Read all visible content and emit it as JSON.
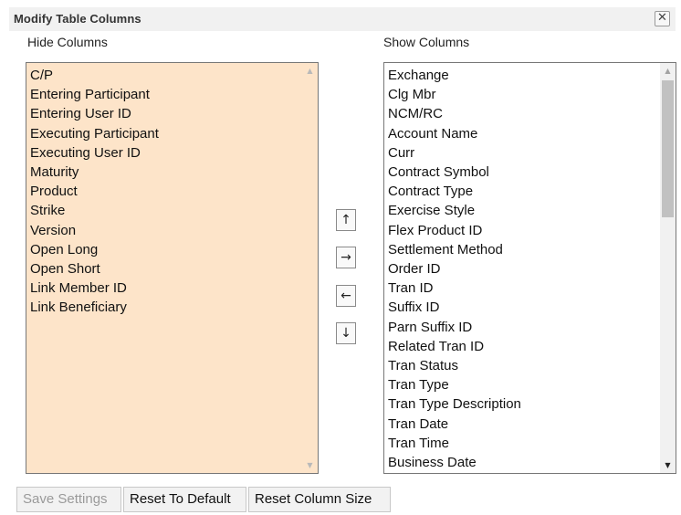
{
  "dialog": {
    "title": "Modify Table Columns",
    "close_symbol": "✕"
  },
  "hide_columns": {
    "label": "Hide Columns",
    "items": [
      "C/P",
      "Entering Participant",
      "Entering User ID",
      "Executing Participant",
      "Executing User ID",
      "Maturity",
      "Product",
      "Strike",
      "Version",
      "Open Long",
      "Open Short",
      "Link Member ID",
      "Link Beneficiary"
    ],
    "background": "#fde4c9"
  },
  "show_columns": {
    "label": "Show Columns",
    "items": [
      "Exchange",
      "Clg Mbr",
      "NCM/RC",
      "Account Name",
      "Curr",
      "Contract Symbol",
      "Contract Type",
      "Exercise Style",
      "Flex Product ID",
      "Settlement Method",
      "Order ID",
      "Tran ID",
      "Suffix ID",
      "Parn Suffix ID",
      "Related Tran ID",
      "Tran Status",
      "Tran Type",
      "Tran Type Description",
      "Tran Date",
      "Tran Time",
      "Business Date"
    ]
  },
  "move_buttons": {
    "up": "↑",
    "right": "→",
    "left": "←",
    "down": "↓"
  },
  "scroll_arrows": {
    "up": "▲",
    "down": "▼"
  },
  "footer": {
    "save_label": "Save Settings",
    "save_enabled": false,
    "reset_default_label": "Reset To Default",
    "reset_column_size_label": "Reset Column Size"
  }
}
